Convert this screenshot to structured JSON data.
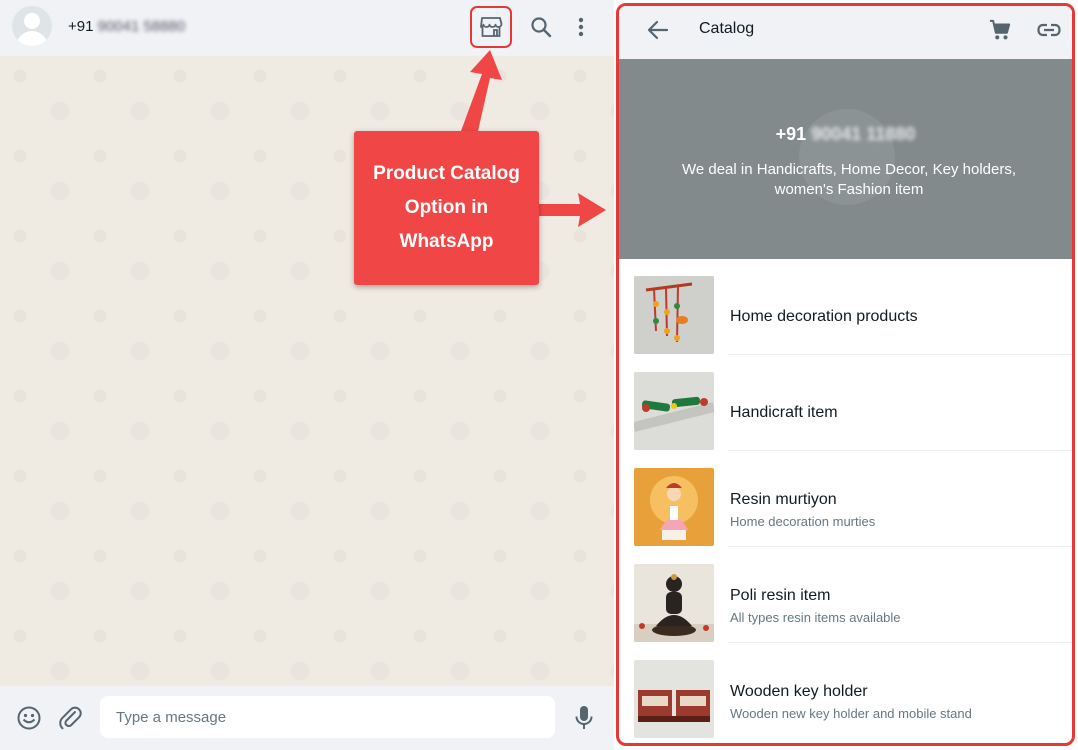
{
  "chat": {
    "contact_prefix": "+91",
    "contact_redacted": "90041 58880",
    "composer_placeholder": "Type a message"
  },
  "callout": {
    "lines": [
      "Product Catalog",
      "Option in",
      "WhatsApp"
    ]
  },
  "catalog": {
    "title": "Catalog",
    "business_prefix": "+91",
    "business_redacted": "90041 11880",
    "description": "We deal in Handicrafts, Home Decor, Key holders, women's Fashion item",
    "items": [
      {
        "title": "Home decoration products",
        "subtitle": ""
      },
      {
        "title": "Handicraft item",
        "subtitle": ""
      },
      {
        "title": "Resin murtiyon",
        "subtitle": "Home decoration murties"
      },
      {
        "title": "Poli resin item",
        "subtitle": "All types resin items available"
      },
      {
        "title": "Wooden key holder",
        "subtitle": "Wooden new key holder and mobile stand"
      }
    ]
  },
  "icons": [
    "store-icon",
    "search-icon",
    "menu-icon",
    "back-icon",
    "cart-icon",
    "link-icon",
    "emoji-icon",
    "attach-icon",
    "mic-icon"
  ],
  "colors": {
    "highlight": "#e53935",
    "callout": "#f14646",
    "banner": "#828a8c",
    "header": "#f0f2f5",
    "wallpaper": "#efeae2"
  }
}
